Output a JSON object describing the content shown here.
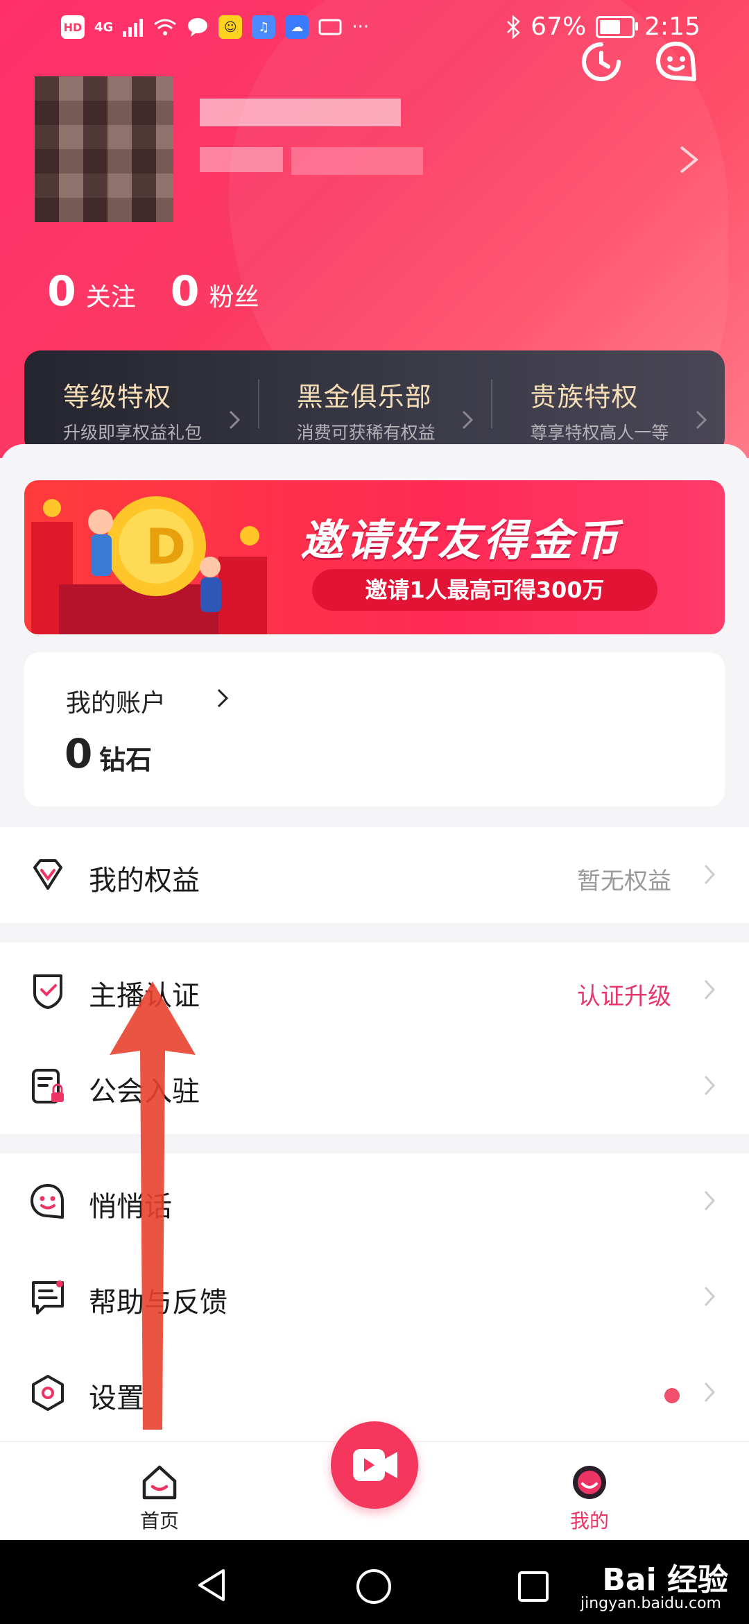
{
  "status_bar": {
    "network": "4G",
    "battery": "67%",
    "battery_level": 0.67,
    "time": "2:15",
    "hd_label": "HD"
  },
  "header": {
    "following_count": "0",
    "following_label": "关注",
    "fans_count": "0",
    "fans_label": "粉丝"
  },
  "privileges": [
    {
      "title": "等级特权",
      "subtitle": "升级即享权益礼包"
    },
    {
      "title": "黑金俱乐部",
      "subtitle": "消费可获稀有权益"
    },
    {
      "title": "贵族特权",
      "subtitle": "尊享特权高人一等"
    }
  ],
  "banner": {
    "title": "邀请好友得金币",
    "subtitle": "邀请1人最高可得300万"
  },
  "account": {
    "title": "我的账户",
    "diamond_count": "0",
    "diamond_unit": "钻石"
  },
  "menu": {
    "rights": {
      "label": "我的权益",
      "value": "暂无权益"
    },
    "anchor": {
      "label": "主播认证",
      "value": "认证升级"
    },
    "guild": {
      "label": "公会入驻"
    },
    "whisper": {
      "label": "悄悄话"
    },
    "help": {
      "label": "帮助与反馈"
    },
    "settings": {
      "label": "设置"
    }
  },
  "tabbar": {
    "home_label": "首页",
    "me_label": "我的"
  },
  "watermark": {
    "brand": "Bai  经验",
    "url": "jingyan.baidu.com"
  },
  "colors": {
    "brand_pink": "#f5375e",
    "accent_text": "#e8356b",
    "privilege_gold": "#f5ddb6"
  }
}
